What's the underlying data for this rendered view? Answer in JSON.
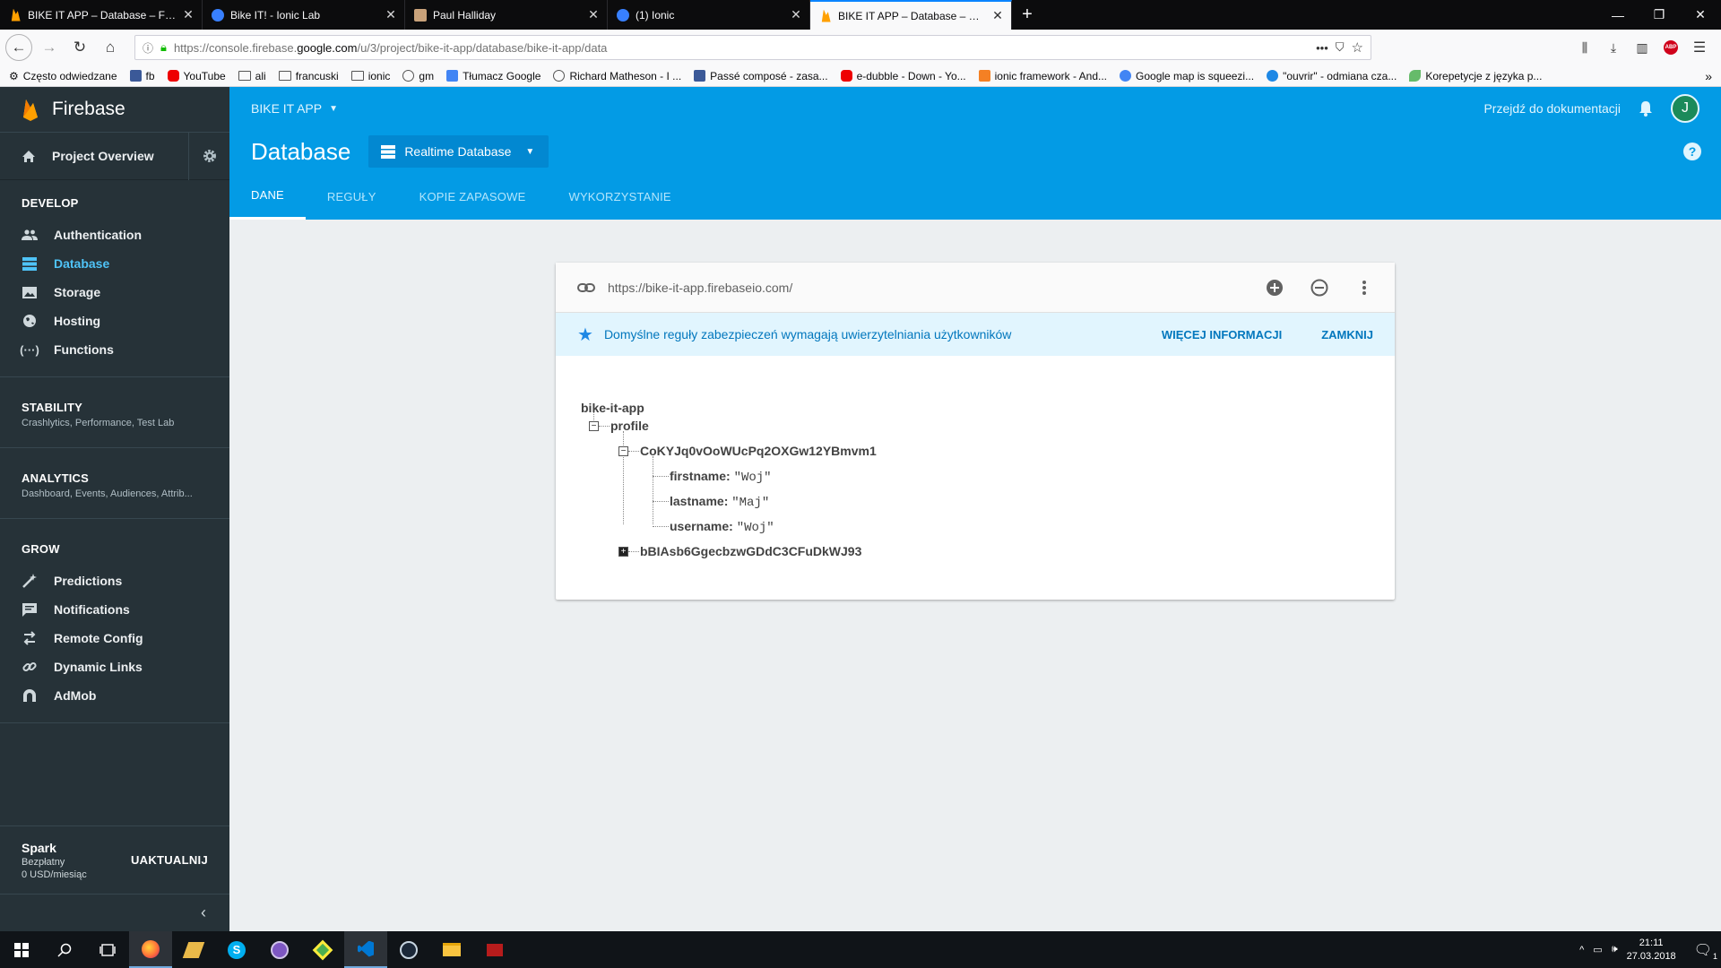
{
  "browser": {
    "tabs": [
      {
        "label": "BIKE IT APP – Database – Firebase",
        "icon": "firebase-icon",
        "active": false
      },
      {
        "label": "Bike IT! - Ionic Lab",
        "icon": "ionic-icon",
        "active": false
      },
      {
        "label": "Paul Halliday",
        "icon": "avatar-icon",
        "active": false
      },
      {
        "label": "(1) Ionic",
        "icon": "ionic-icon",
        "active": false
      },
      {
        "label": "BIKE IT APP – Database – Firebase",
        "icon": "firebase-icon",
        "active": true
      }
    ],
    "url": {
      "prefix": "https://console.firebase.",
      "domain": "google.com",
      "suffix": "/u/3/project/bike-it-app/database/bike-it-app/data"
    },
    "bookmarks": [
      {
        "label": "Często odwiedzane",
        "icon": "gear-icon"
      },
      {
        "label": "fb",
        "icon": "facebook-icon"
      },
      {
        "label": "YouTube",
        "icon": "youtube-icon"
      },
      {
        "label": "ali",
        "icon": "folder-icon"
      },
      {
        "label": "francuski",
        "icon": "folder-icon"
      },
      {
        "label": "ionic",
        "icon": "folder-icon"
      },
      {
        "label": "gm",
        "icon": "globe-icon"
      },
      {
        "label": "Tłumacz Google",
        "icon": "translate-icon"
      },
      {
        "label": "Richard Matheson - I ...",
        "icon": "globe-icon"
      },
      {
        "label": "Passé composé - zasa...",
        "icon": "facebook-icon"
      },
      {
        "label": "e-dubble - Down - Yo...",
        "icon": "youtube-icon"
      },
      {
        "label": "ionic framework - And...",
        "icon": "stackoverflow-icon"
      },
      {
        "label": "Google map is squeezi...",
        "icon": "google-icon"
      },
      {
        "label": "\"ouvrir\" - odmiana cza...",
        "icon": "chat-icon"
      },
      {
        "label": "Korepetycje z języka p...",
        "icon": "leaf-icon"
      }
    ]
  },
  "sidebar": {
    "brand": "Firebase",
    "project_overview": "Project Overview",
    "develop": {
      "title": "DEVELOP",
      "items": [
        {
          "label": "Authentication",
          "icon": "people-icon"
        },
        {
          "label": "Database",
          "icon": "database-icon",
          "active": true
        },
        {
          "label": "Storage",
          "icon": "image-icon"
        },
        {
          "label": "Hosting",
          "icon": "globe-icon"
        },
        {
          "label": "Functions",
          "icon": "functions-icon"
        }
      ]
    },
    "stability": {
      "title": "STABILITY",
      "subtitle": "Crashlytics, Performance, Test Lab"
    },
    "analytics": {
      "title": "ANALYTICS",
      "subtitle": "Dashboard, Events, Audiences, Attrib..."
    },
    "grow": {
      "title": "GROW",
      "items": [
        {
          "label": "Predictions",
          "icon": "wand-icon"
        },
        {
          "label": "Notifications",
          "icon": "message-icon"
        },
        {
          "label": "Remote Config",
          "icon": "remote-config-icon"
        },
        {
          "label": "Dynamic Links",
          "icon": "link-icon"
        },
        {
          "label": "AdMob",
          "icon": "admob-icon"
        }
      ]
    },
    "plan": {
      "name": "Spark",
      "line1": "Bezpłatny",
      "line2": "0 USD/miesiąc",
      "upgrade": "UAKTUALNIJ"
    }
  },
  "header": {
    "project": "BIKE IT APP",
    "docs": "Przejdź do dokumentacji",
    "avatar": "J",
    "title": "Database",
    "db_selector": "Realtime Database",
    "tabs": [
      "DANE",
      "REGUŁY",
      "KOPIE ZAPASOWE",
      "WYKORZYSTANIE"
    ]
  },
  "card": {
    "url": "https://bike-it-app.firebaseio.com/",
    "banner": "Domyślne reguły zabezpieczeń wymagają uwierzytelniania użytkowników",
    "more_info": "WIĘCEJ INFORMACJI",
    "close": "ZAMKNIJ",
    "tree": {
      "root": "bike-it-app",
      "profile": "profile",
      "user1": "CoKYJq0vOoWUcPq2OXGw12YBmvm1",
      "fields": [
        {
          "key": "firstname:",
          "value": "\"Woj\""
        },
        {
          "key": "lastname:",
          "value": "\"Maj\""
        },
        {
          "key": "username:",
          "value": "\"Woj\""
        }
      ],
      "user2": "bBIAsb6GgecbzwGDdC3CFuDkWJ93"
    }
  },
  "taskbar": {
    "time": "21:11",
    "date": "27.03.2018",
    "notifications": "1"
  }
}
